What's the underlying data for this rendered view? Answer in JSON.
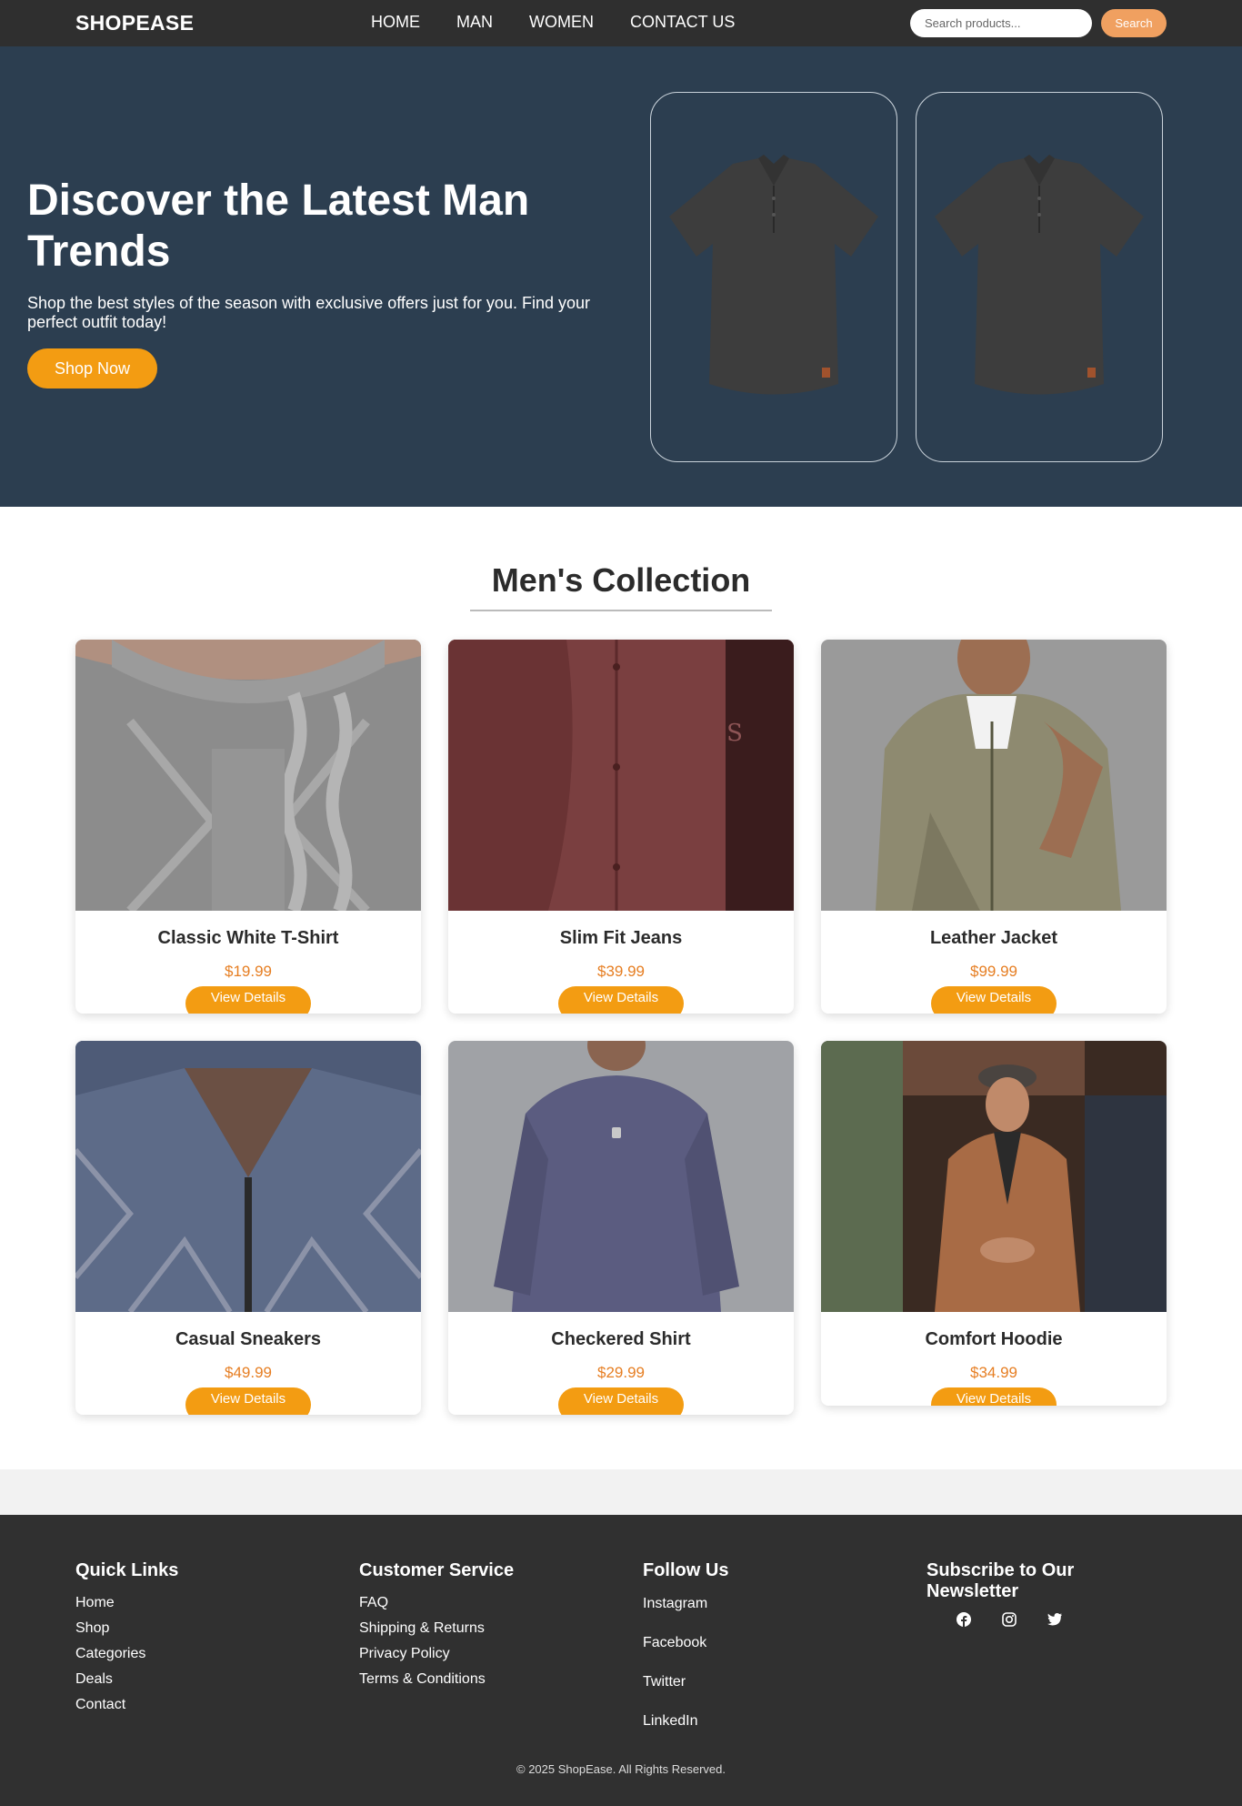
{
  "navbar": {
    "brand": "SHOPEASE",
    "links": [
      "HOME",
      "MAN",
      "WOMEN",
      "CONTACT US"
    ],
    "search_placeholder": "Search products...",
    "search_button": "Search"
  },
  "hero": {
    "title": "Discover the Latest Man Trends",
    "subtitle": "Shop the best styles of the season with exclusive offers just for you. Find your perfect outfit today!",
    "cta": "Shop Now"
  },
  "collection": {
    "title": "Men's Collection",
    "products": [
      {
        "name": "Classic White T-Shirt",
        "price": "$19.99",
        "button": "View Details"
      },
      {
        "name": "Slim Fit Jeans",
        "price": "$39.99",
        "button": "View Details"
      },
      {
        "name": "Leather Jacket",
        "price": "$99.99",
        "button": "View Details"
      },
      {
        "name": "Casual Sneakers",
        "price": "$49.99",
        "button": "View Details"
      },
      {
        "name": "Checkered Shirt",
        "price": "$29.99",
        "button": "View Details"
      },
      {
        "name": "Comfort Hoodie",
        "price": "$34.99",
        "button": "View Details"
      }
    ]
  },
  "footer": {
    "quick_links": {
      "title": "Quick Links",
      "items": [
        "Home",
        "Shop",
        "Categories",
        "Deals",
        "Contact"
      ]
    },
    "customer_service": {
      "title": "Customer Service",
      "items": [
        "FAQ",
        "Shipping & Returns",
        "Privacy Policy",
        "Terms & Conditions"
      ]
    },
    "follow_us": {
      "title": "Follow Us",
      "items": [
        "Instagram",
        "Facebook",
        "Twitter",
        "LinkedIn"
      ]
    },
    "newsletter": {
      "title": "Subscribe to Our Newsletter",
      "icons": [
        "facebook-icon",
        "instagram-icon",
        "twitter-icon"
      ]
    },
    "copyright": "© 2025 ShopEase. All Rights Reserved."
  },
  "colors": {
    "navbar_bg": "#2f2f2f",
    "hero_bg": "#2c3e50",
    "accent_orange": "#f39c12",
    "price_orange": "#e67e22",
    "footer_bg": "#303030"
  }
}
